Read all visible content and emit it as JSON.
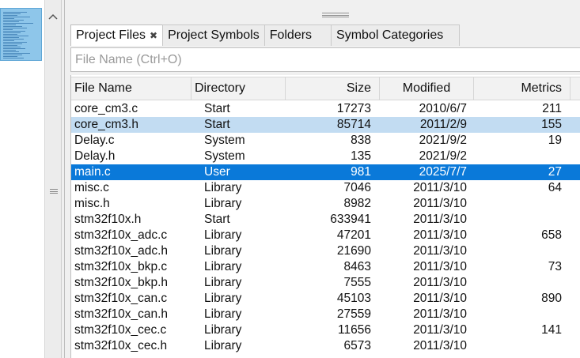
{
  "tabs": [
    {
      "label": "Project Files",
      "active": true,
      "closable": true
    },
    {
      "label": "Project Symbols",
      "active": false
    },
    {
      "label": "Folders",
      "active": false
    },
    {
      "label": "Symbol Categories",
      "active": false
    }
  ],
  "search": {
    "placeholder": "File Name (Ctrl+O)",
    "value": ""
  },
  "columns": [
    "File Name",
    "Directory",
    "Size",
    "Modified",
    "Metrics"
  ],
  "rows": [
    {
      "name": "core_cm3.c",
      "dir": "Start",
      "size": "17273",
      "modified": "2010/6/7",
      "metrics": "211",
      "state": "normal"
    },
    {
      "name": "core_cm3.h",
      "dir": "Start",
      "size": "85714",
      "modified": "2011/2/9",
      "metrics": "155",
      "state": "highlighted"
    },
    {
      "name": "Delay.c",
      "dir": "System",
      "size": "838",
      "modified": "2021/9/2",
      "metrics": "19",
      "state": "normal"
    },
    {
      "name": "Delay.h",
      "dir": "System",
      "size": "135",
      "modified": "2021/9/2",
      "metrics": "",
      "state": "normal"
    },
    {
      "name": "main.c",
      "dir": "User",
      "size": "981",
      "modified": "2025/7/7",
      "metrics": "27",
      "state": "selected"
    },
    {
      "name": "misc.c",
      "dir": "Library",
      "size": "7046",
      "modified": "2011/3/10",
      "metrics": "64",
      "state": "normal"
    },
    {
      "name": "misc.h",
      "dir": "Library",
      "size": "8982",
      "modified": "2011/3/10",
      "metrics": "",
      "state": "normal"
    },
    {
      "name": "stm32f10x.h",
      "dir": "Start",
      "size": "633941",
      "modified": "2011/3/10",
      "metrics": "",
      "state": "normal"
    },
    {
      "name": "stm32f10x_adc.c",
      "dir": "Library",
      "size": "47201",
      "modified": "2011/3/10",
      "metrics": "658",
      "state": "normal"
    },
    {
      "name": "stm32f10x_adc.h",
      "dir": "Library",
      "size": "21690",
      "modified": "2011/3/10",
      "metrics": "",
      "state": "normal"
    },
    {
      "name": "stm32f10x_bkp.c",
      "dir": "Library",
      "size": "8463",
      "modified": "2011/3/10",
      "metrics": "73",
      "state": "normal"
    },
    {
      "name": "stm32f10x_bkp.h",
      "dir": "Library",
      "size": "7555",
      "modified": "2011/3/10",
      "metrics": "",
      "state": "normal"
    },
    {
      "name": "stm32f10x_can.c",
      "dir": "Library",
      "size": "45103",
      "modified": "2011/3/10",
      "metrics": "890",
      "state": "normal"
    },
    {
      "name": "stm32f10x_can.h",
      "dir": "Library",
      "size": "27559",
      "modified": "2011/3/10",
      "metrics": "",
      "state": "normal"
    },
    {
      "name": "stm32f10x_cec.c",
      "dir": "Library",
      "size": "11656",
      "modified": "2011/3/10",
      "metrics": "141",
      "state": "normal"
    },
    {
      "name": "stm32f10x_cec.h",
      "dir": "Library",
      "size": "6573",
      "modified": "2011/3/10",
      "metrics": "",
      "state": "normal"
    }
  ],
  "icons": {
    "scroll_up": "chevron-up-icon",
    "tab_close": "close-icon",
    "splitter_grip": "grip-icon"
  },
  "colors": {
    "selected_row": "#0a79d9",
    "highlighted_row": "#c2dcf2",
    "minimap": "#8ec6ea"
  }
}
